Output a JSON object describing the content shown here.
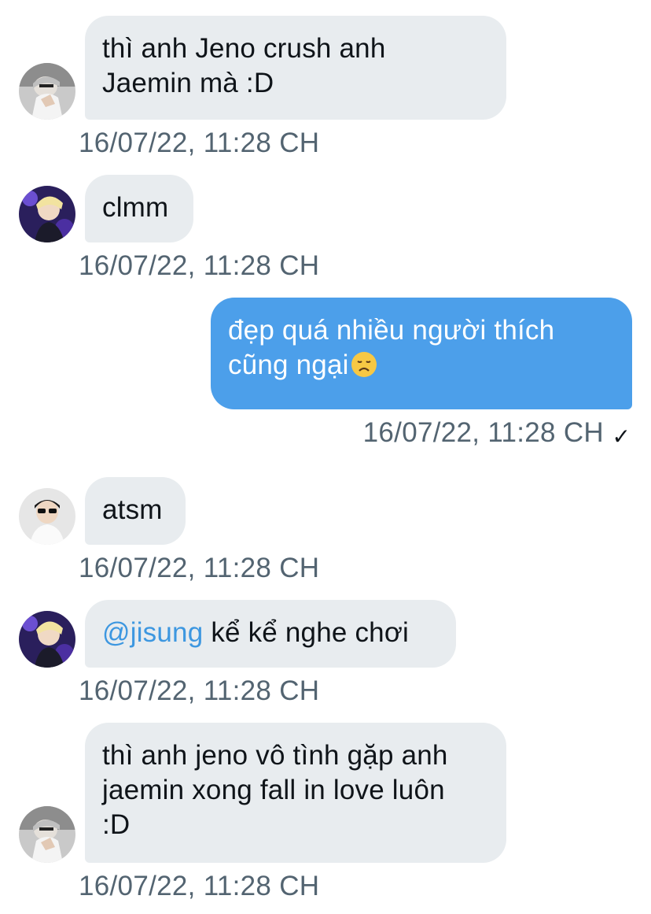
{
  "messages": [
    {
      "sender": "user-a",
      "direction": "in",
      "lines": [
        "thì anh Jeno crush anh",
        "Jaemin mà :D"
      ],
      "timestamp": "16/07/22, 11:28 CH"
    },
    {
      "sender": "user-b",
      "direction": "in",
      "lines": [
        "clmm"
      ],
      "timestamp": "16/07/22, 11:28 CH"
    },
    {
      "sender": "me",
      "direction": "out",
      "lines": [
        "đẹp quá nhiều người thích",
        "cũng ngại"
      ],
      "emoji": "disappointed-face-icon",
      "timestamp": "16/07/22, 11:28 CH",
      "status_icon": "check-icon",
      "status_glyph": "✓"
    },
    {
      "sender": "user-c",
      "direction": "in",
      "lines": [
        "atsm"
      ],
      "timestamp": "16/07/22, 11:28 CH"
    },
    {
      "sender": "user-b",
      "direction": "in",
      "mention": "@jisung",
      "lines": [
        " kể kể nghe chơi"
      ],
      "timestamp": "16/07/22, 11:28 CH"
    },
    {
      "sender": "user-a",
      "direction": "in",
      "lines": [
        "thì anh jeno vô tình gặp anh",
        "jaemin xong fall in love luôn",
        ":D"
      ],
      "timestamp": "16/07/22, 11:28 CH"
    }
  ],
  "colors": {
    "incoming_bubble": "#e8ecef",
    "outgoing_bubble": "#4c9fea",
    "mention": "#3d97e0",
    "timestamp": "#536471"
  }
}
